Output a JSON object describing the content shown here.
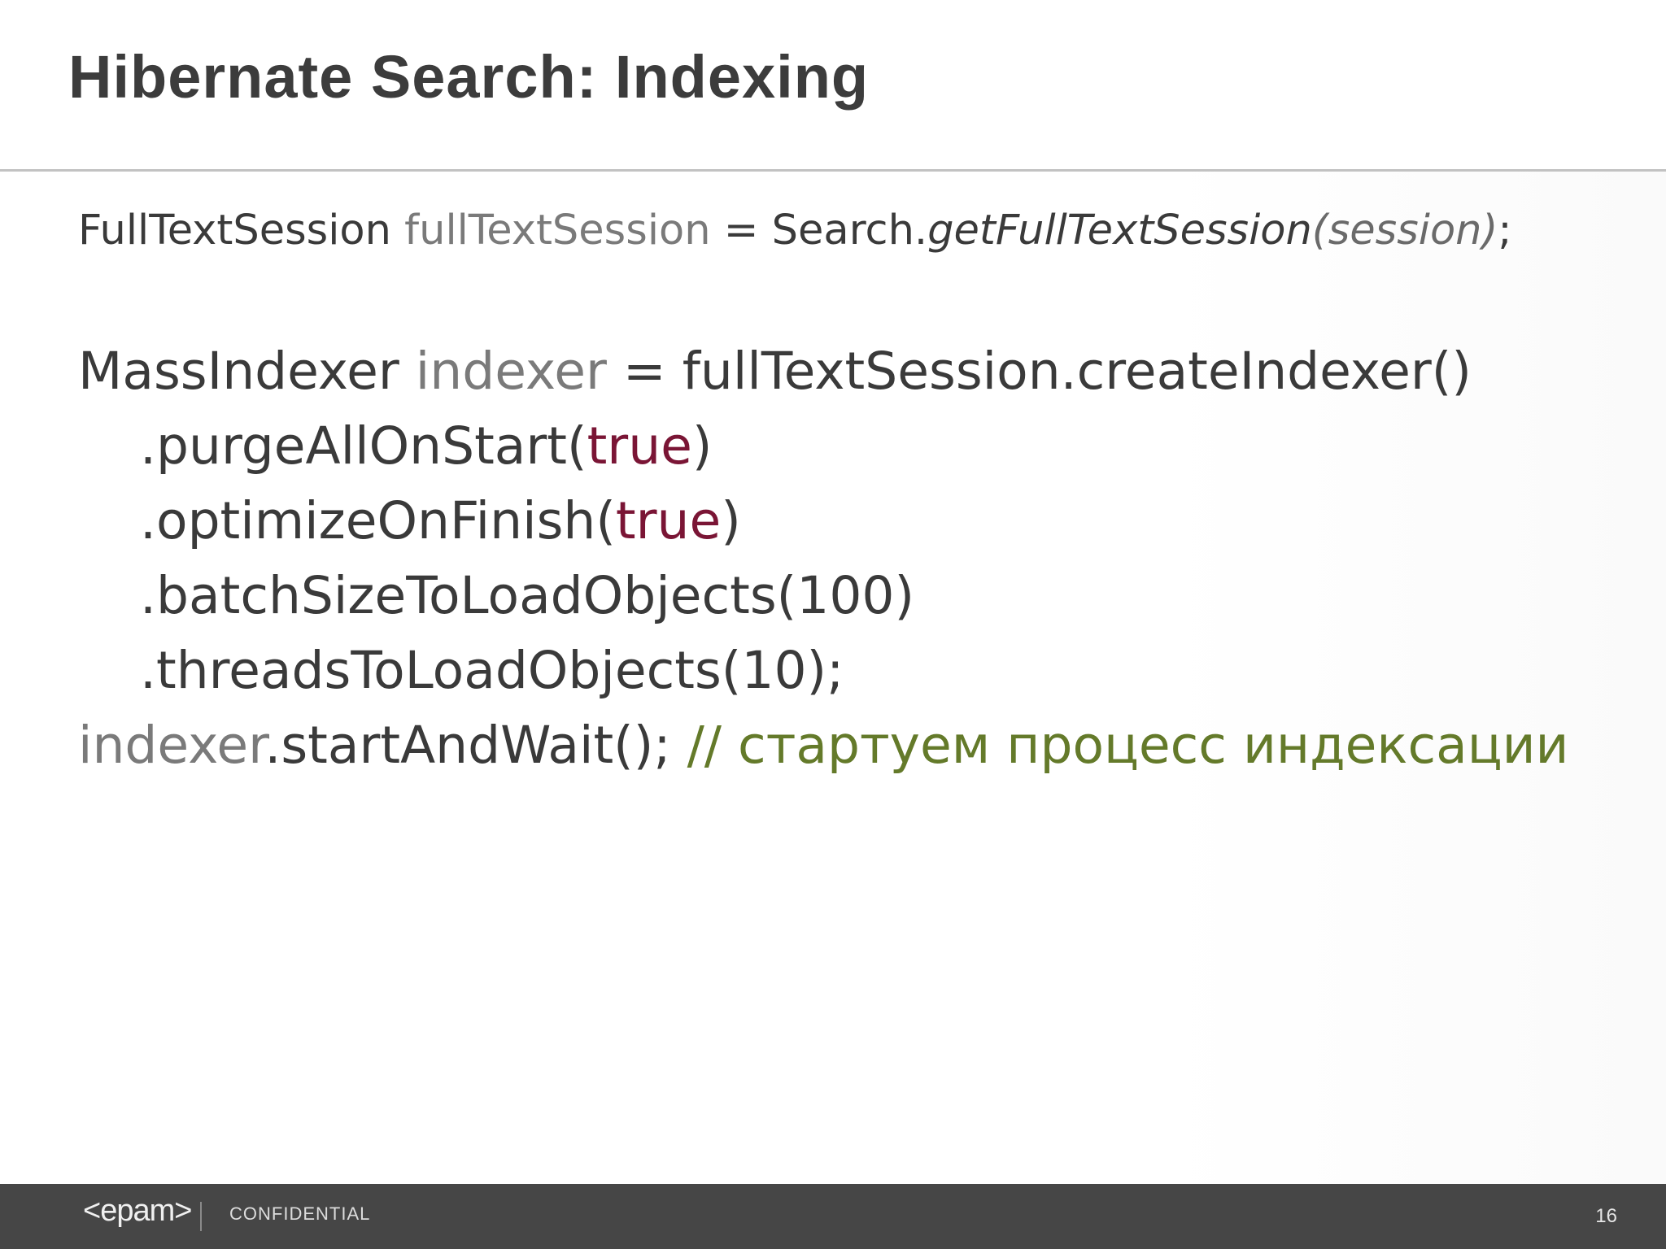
{
  "slide": {
    "title": "Hibernate Search: Indexing"
  },
  "code": {
    "line1": {
      "type": "FullTextSession",
      "var": "fullTextSession",
      "op": " = Search.",
      "method": "getFullTextSession",
      "args": "(session)",
      "end": ";"
    },
    "line2": {
      "type": "MassIndexer",
      "var": "indexer",
      "rest": " = fullTextSession.createIndexer()"
    },
    "line3": {
      "pre": ".purgeAllOnStart(",
      "kw": "true",
      "post": ")"
    },
    "line4": {
      "pre": ".optimizeOnFinish(",
      "kw": "true",
      "post": ")"
    },
    "line5": {
      "text": ".batchSizeToLoadObjects(100)"
    },
    "line6": {
      "text": ".threadsToLoadObjects(10);"
    },
    "line7": {
      "var": "indexer",
      "rest": ".startAndWait(); ",
      "comment": "// стартуем процесс индексации"
    }
  },
  "footer": {
    "logo": "<epam>",
    "confidential": "CONFIDENTIAL",
    "page_number": "16"
  },
  "colors": {
    "title": "#3c3c3c",
    "code_text": "#3a3a3a",
    "variable": "#7a7a7a",
    "keyword": "#7a1535",
    "comment": "#647a2a",
    "footer_bg": "#464646"
  }
}
